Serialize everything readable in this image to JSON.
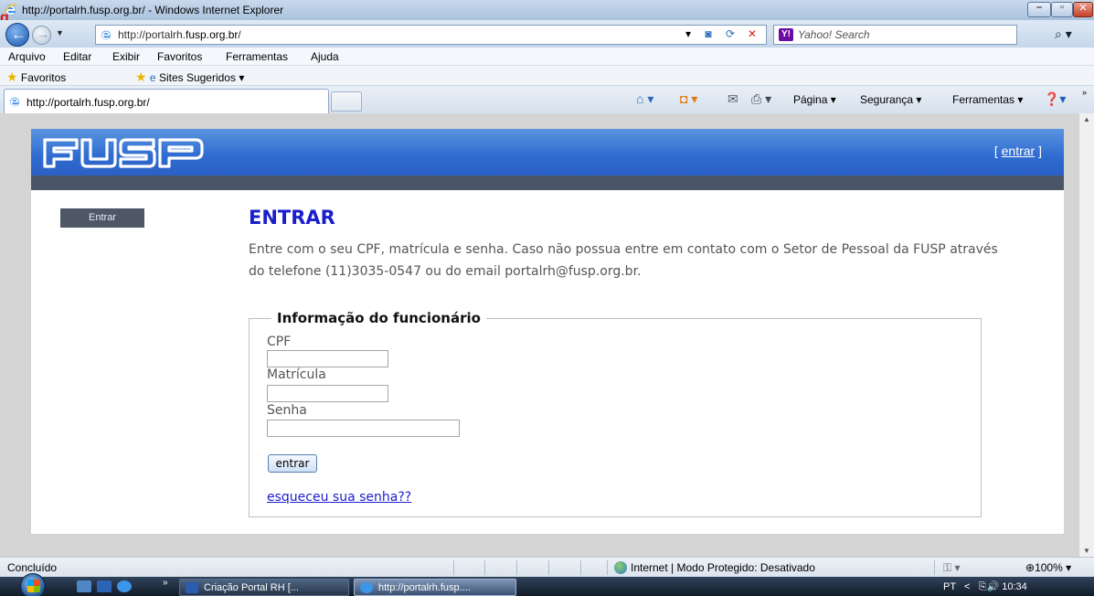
{
  "window": {
    "title": "http://portalrh.fusp.org.br/ - Windows Internet Explorer",
    "corner_mark": "g"
  },
  "addressbar": {
    "url_prefix": "http://portalrh.",
    "url_domain": "fusp.org.br",
    "url_suffix": "/",
    "search_placeholder": "Yahoo! Search",
    "search_provider_icon": "Y!"
  },
  "menu": [
    "Arquivo",
    "Editar",
    "Exibir",
    "Favoritos",
    "Ferramentas",
    "Ajuda"
  ],
  "favorites": {
    "favorites_label": "Favoritos",
    "suggested_label": "Sites Sugeridos"
  },
  "tab": {
    "label": "http://portalrh.fusp.org.br/"
  },
  "commandbar": {
    "page": "Página",
    "security": "Segurança",
    "tools": "Ferramentas"
  },
  "site": {
    "logo_text": "FUSP",
    "top_link_open": "[ ",
    "top_link": "entrar",
    "top_link_close": " ]",
    "side_button": "Entrar",
    "heading": "ENTRAR",
    "intro": "Entre com o seu CPF, matrícula e senha. Caso não possua entre em contato com o Setor de Pessoal da FUSP através do telefone (11)3035-0547 ou do email portalrh@fusp.org.br.",
    "form": {
      "legend": "Informação do funcionário",
      "cpf_label": "CPF",
      "cpf_value": "",
      "matricula_label": "Matrícula",
      "matricula_value": "",
      "senha_label": "Senha",
      "senha_value": "",
      "submit_label": "entrar",
      "forgot_link": "esqueceu sua senha??"
    },
    "colors": {
      "header_blue": "#2f6bd0",
      "stripe": "#4a5568",
      "heading_blue": "#1a1ecc"
    }
  },
  "statusbar": {
    "status": "Concluído",
    "zone": "Internet | Modo Protegido: Desativado",
    "zoom": "100%"
  },
  "taskbar": {
    "task1": "Criação Portal RH [...",
    "task2": "http://portalrh.fusp....",
    "lang": "PT",
    "time": "10:34"
  }
}
